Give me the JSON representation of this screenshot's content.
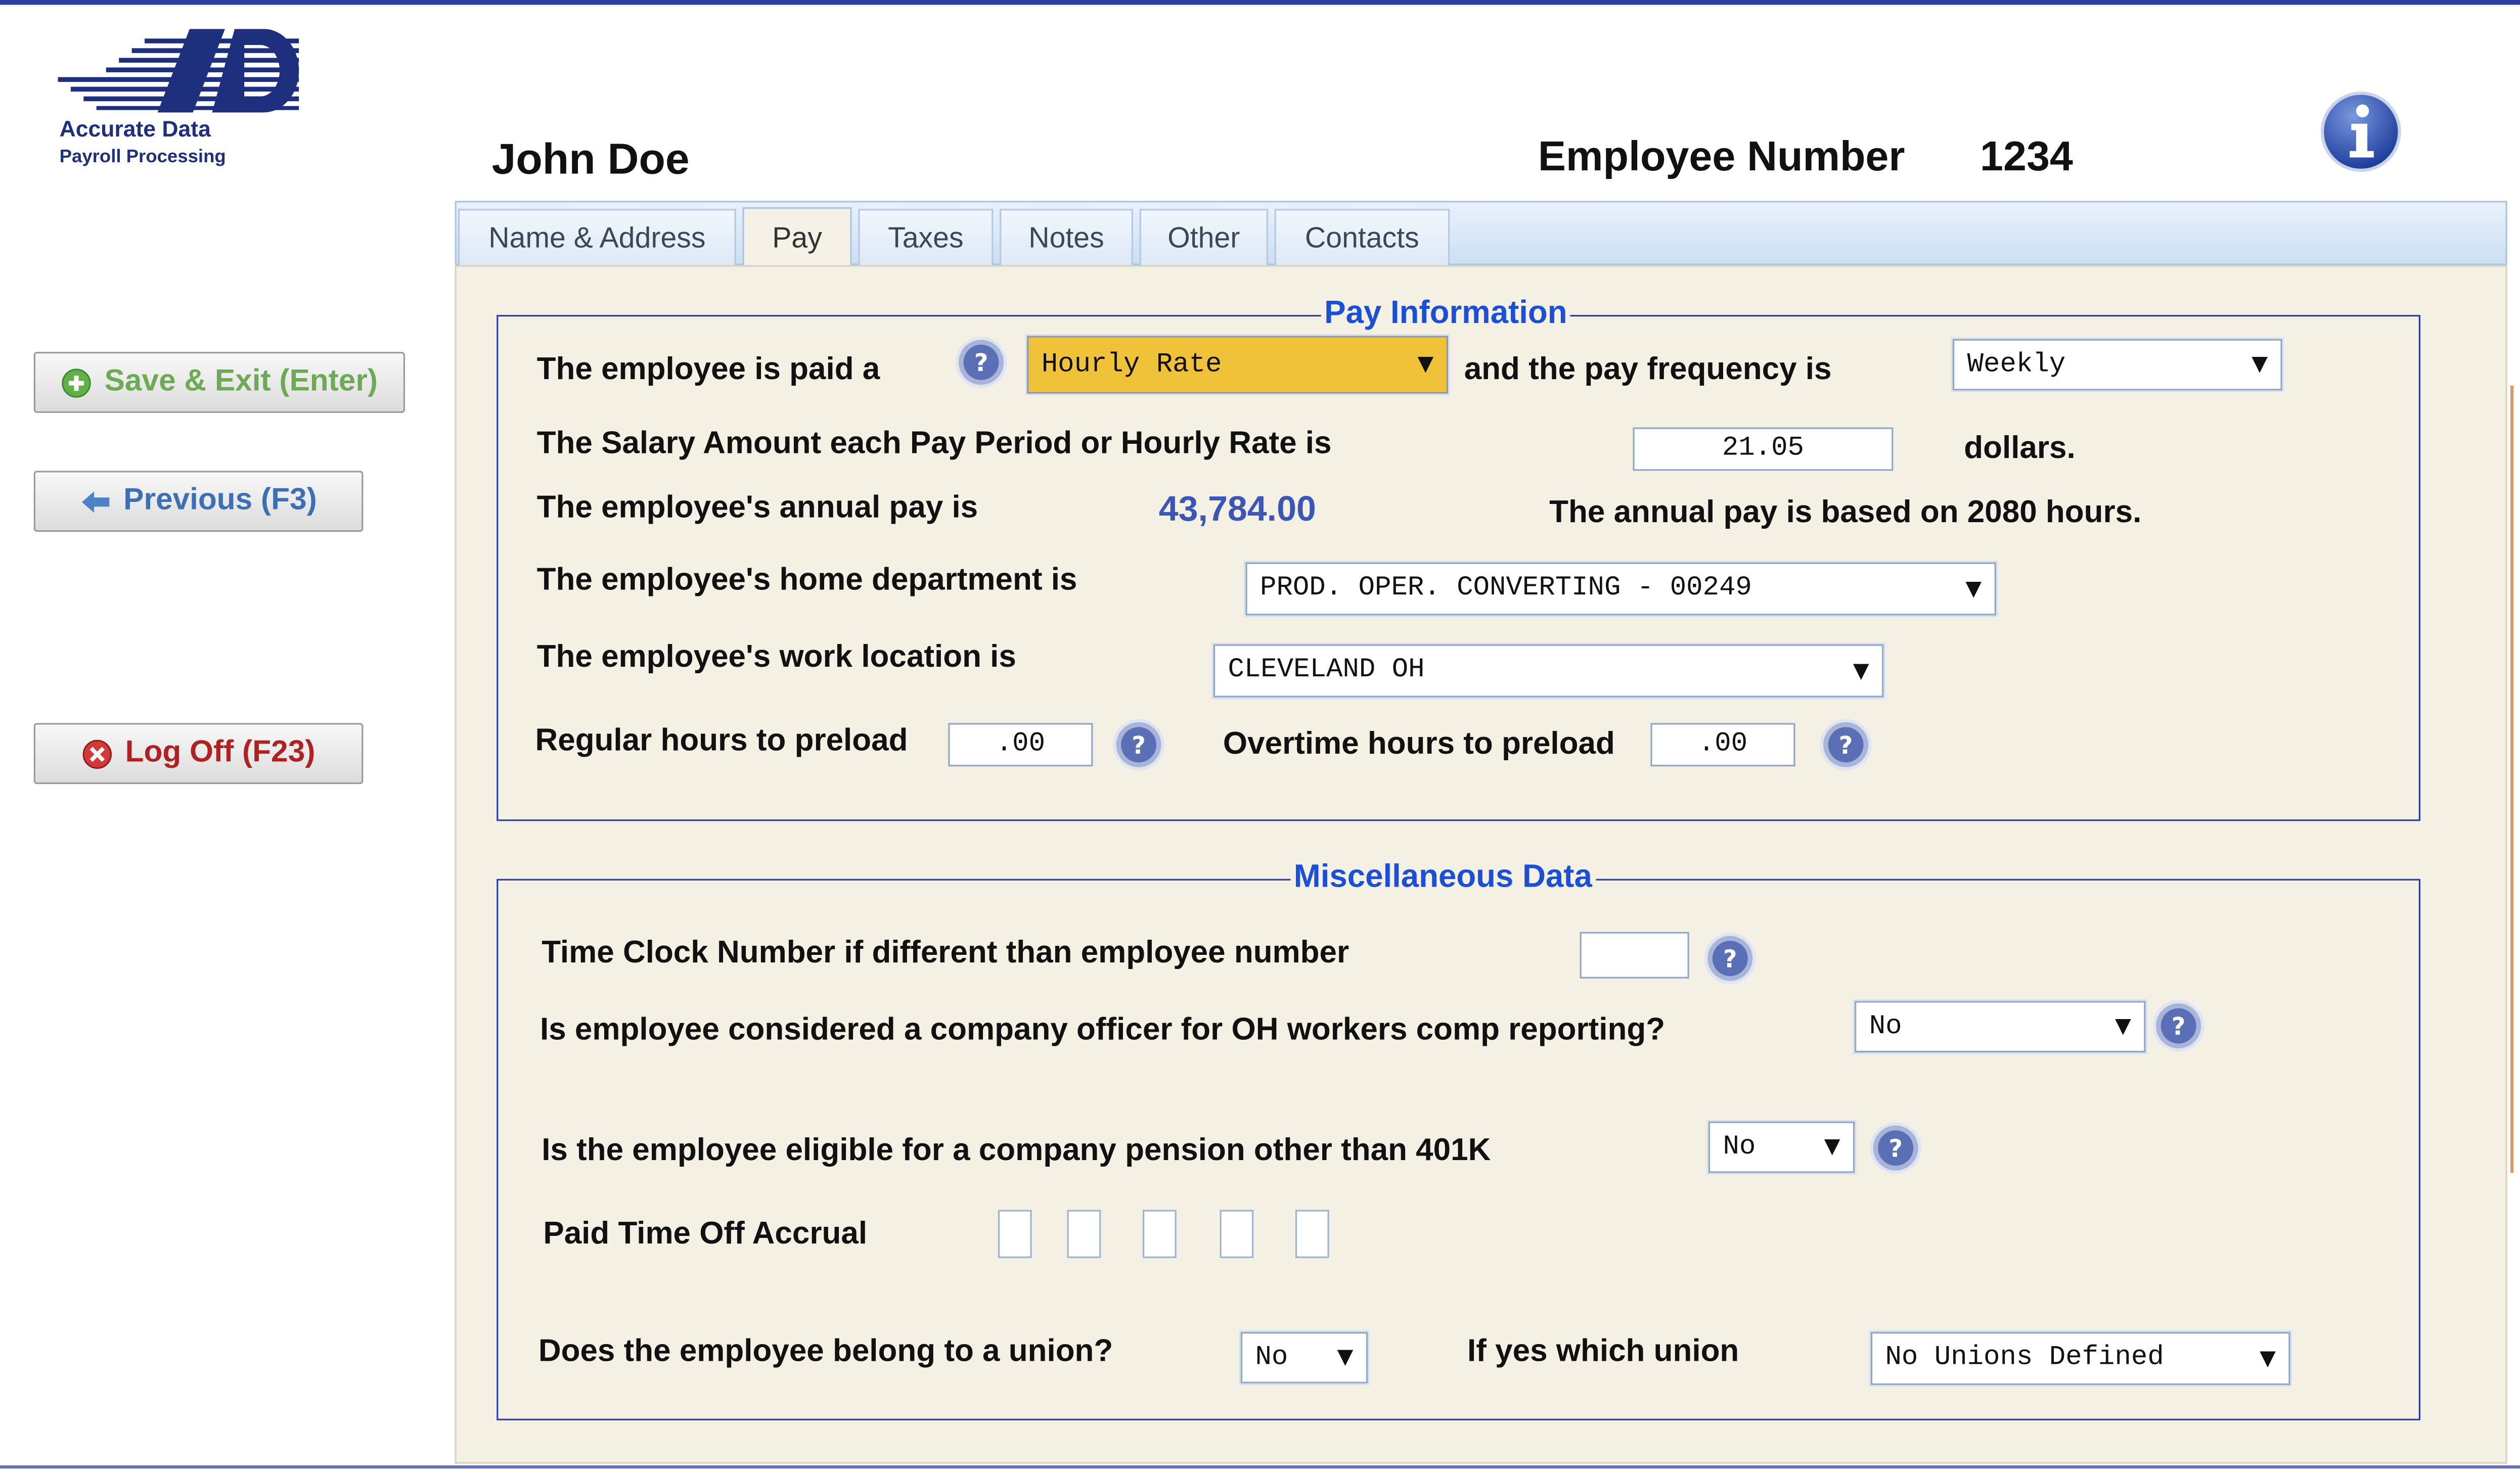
{
  "company": {
    "name": "Accurate Data",
    "subtitle": "Payroll Processing"
  },
  "employee": {
    "name": "John Doe",
    "number_label": "Employee Number",
    "number": "1234"
  },
  "sidebar": {
    "save": "Save & Exit (Enter)",
    "previous": "Previous (F3)",
    "logoff": "Log Off (F23)"
  },
  "tabs": [
    "Name & Address",
    "Pay",
    "Taxes",
    "Notes",
    "Other",
    "Contacts"
  ],
  "active_tab": "Pay",
  "pay_info": {
    "legend": "Pay Information",
    "paid_a_label": "The employee is paid a",
    "pay_type": "Hourly Rate",
    "freq_label": "and the pay frequency is",
    "frequency": "Weekly",
    "salary_label": "The Salary Amount each Pay Period or Hourly Rate is",
    "salary_amount": "21.05",
    "salary_unit": "dollars.",
    "annual_label": "The employee's annual pay is",
    "annual_pay": "43,784.00",
    "annual_basis": "The annual pay is based on 2080 hours.",
    "dept_label": "The employee's home department is",
    "department": "PROD. OPER. CONVERTING - 00249",
    "location_label": "The employee's work location is",
    "location": "CLEVELAND OH",
    "reg_hours_label": "Regular hours to preload",
    "reg_hours": ".00",
    "ot_hours_label": "Overtime hours to preload",
    "ot_hours": ".00"
  },
  "misc": {
    "legend": "Miscellaneous Data",
    "timeclock_label": "Time Clock Number if different than employee number",
    "timeclock": "",
    "officer_label": "Is employee considered a company officer for OH workers comp reporting?",
    "officer": "No",
    "pension_label": "Is the employee eligible for a company pension other than 401K",
    "pension": "No",
    "pto_label": "Paid Time Off Accrual",
    "pto_boxes": [
      "",
      "",
      "",
      "",
      ""
    ],
    "union_label": "Does the employee belong to a union?",
    "union": "No",
    "which_union_label": "If yes which union",
    "which_union": "No Unions Defined"
  },
  "colors": {
    "accent_blue": "#1c4fd8",
    "panel_bg": "#f4f0e4",
    "pay_type_highlight": "#f0c23a",
    "save_green": "#6cab54",
    "logoff_red": "#b02121"
  },
  "icons": {
    "help": "question-circle-icon",
    "info": "info-circle-icon",
    "save": "plus-circle-icon",
    "previous": "arrow-left-icon",
    "logoff": "x-circle-icon"
  }
}
